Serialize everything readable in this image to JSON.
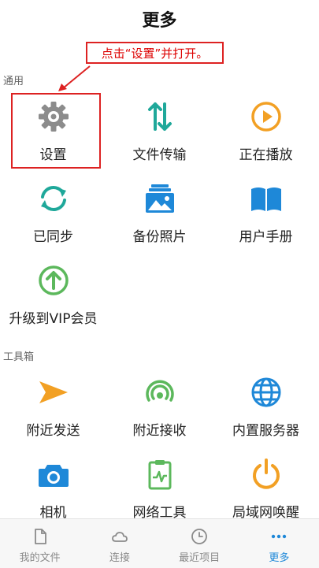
{
  "header": {
    "title": "更多"
  },
  "annotation": {
    "note": "点击“设置”并打开。"
  },
  "sections": {
    "general": {
      "label": "通用",
      "items": [
        {
          "label": "设置",
          "icon": "gear-icon"
        },
        {
          "label": "文件传输",
          "icon": "transfer-arrows-icon"
        },
        {
          "label": "正在播放",
          "icon": "play-circle-icon"
        },
        {
          "label": "已同步",
          "icon": "sync-icon"
        },
        {
          "label": "备份照片",
          "icon": "photo-backup-icon"
        },
        {
          "label": "用户手册",
          "icon": "book-icon"
        },
        {
          "label": "升级到VIP会员",
          "icon": "upgrade-arrow-icon"
        }
      ]
    },
    "toolbox": {
      "label": "工具箱",
      "items": [
        {
          "label": "附近发送",
          "icon": "send-icon"
        },
        {
          "label": "附近接收",
          "icon": "receive-signal-icon"
        },
        {
          "label": "内置服务器",
          "icon": "globe-icon"
        },
        {
          "label": "相机",
          "icon": "camera-icon"
        },
        {
          "label": "网络工具",
          "icon": "clipboard-pulse-icon"
        },
        {
          "label": "局域网唤醒",
          "icon": "power-icon"
        }
      ]
    }
  },
  "tabbar": {
    "tabs": [
      {
        "label": "我的文件",
        "icon": "file-icon"
      },
      {
        "label": "连接",
        "icon": "cloud-icon"
      },
      {
        "label": "最近项目",
        "icon": "clock-icon"
      },
      {
        "label": "更多",
        "icon": "more-dots-icon"
      }
    ],
    "active_index": 3
  },
  "colors": {
    "gray": "#8c8c8c",
    "teal": "#1fa89a",
    "orange": "#f2a024",
    "green": "#5cb85c",
    "blue": "#1e88d8",
    "annotation_red": "#dd2222"
  }
}
